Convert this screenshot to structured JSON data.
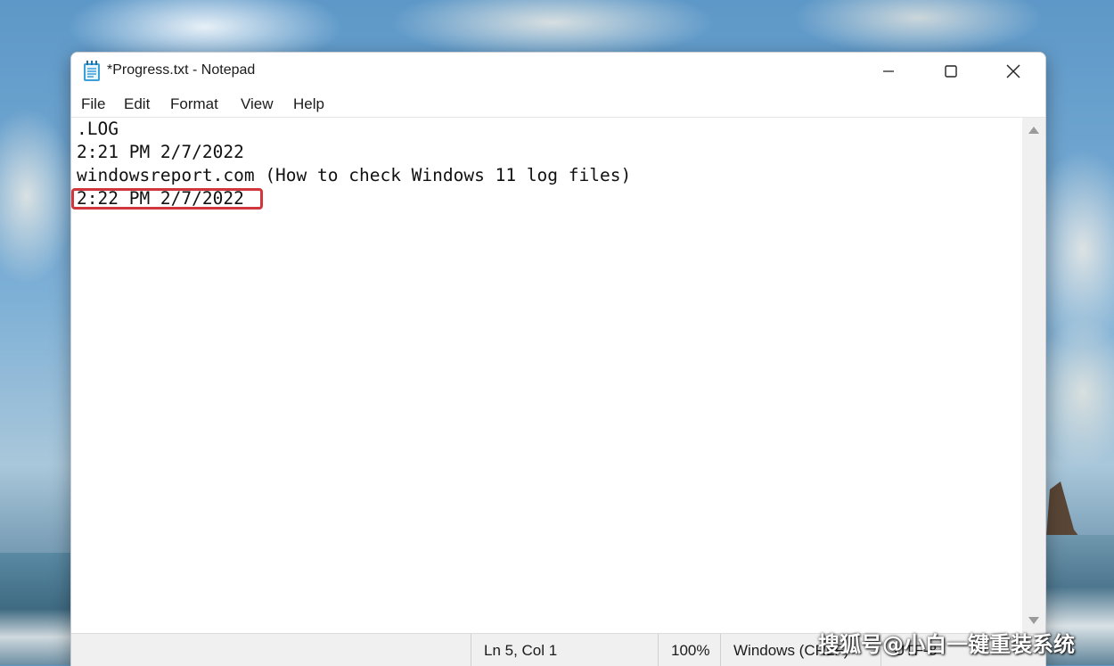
{
  "window": {
    "title": "*Progress.txt - Notepad",
    "app_icon": "notepad-icon",
    "controls": {
      "minimize": "minimize-icon",
      "maximize": "maximize-icon",
      "close": "close-icon"
    }
  },
  "menu": {
    "items": [
      {
        "label": "File"
      },
      {
        "label": "Edit"
      },
      {
        "label": "Format"
      },
      {
        "label": "View"
      },
      {
        "label": "Help"
      }
    ]
  },
  "editor": {
    "lines": [
      ".LOG",
      "2:21 PM 2/7/2022",
      "windowsreport.com (How to check Windows 11 log files)",
      "2:22 PM 2/7/2022"
    ],
    "highlight_color": "#d0373c"
  },
  "status": {
    "position": "Ln 5, Col 1",
    "zoom": "100%",
    "line_ending": "Windows (CRLF)",
    "encoding": "UTF-8"
  },
  "watermark": "搜狐号@小白一键重装系统"
}
